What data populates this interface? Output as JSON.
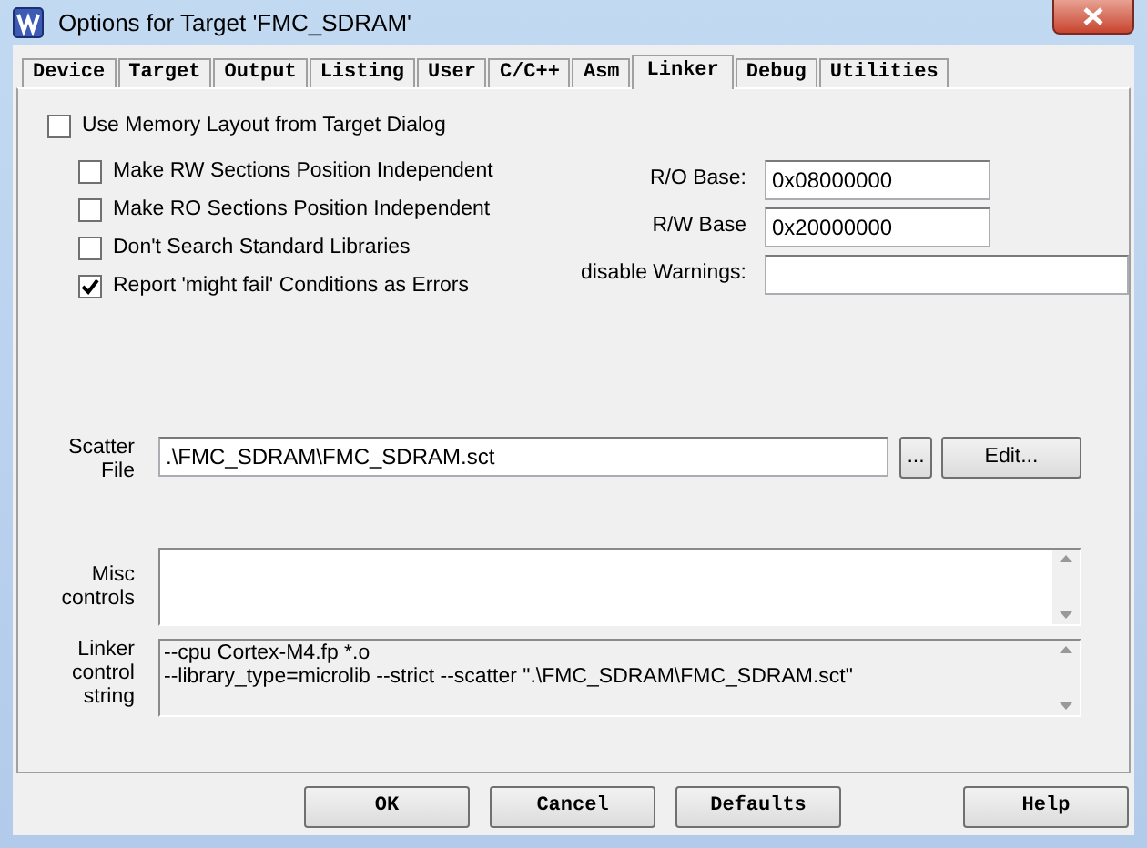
{
  "window": {
    "title": "Options for Target 'FMC_SDRAM'"
  },
  "tabs": [
    {
      "label": "Device",
      "selected": false
    },
    {
      "label": "Target",
      "selected": false
    },
    {
      "label": "Output",
      "selected": false
    },
    {
      "label": "Listing",
      "selected": false
    },
    {
      "label": "User",
      "selected": false
    },
    {
      "label": "C/C++",
      "selected": false
    },
    {
      "label": "Asm",
      "selected": false
    },
    {
      "label": "Linker",
      "selected": true
    },
    {
      "label": "Debug",
      "selected": false
    },
    {
      "label": "Utilities",
      "selected": false
    }
  ],
  "memory_layout": {
    "label": "Use Memory Layout from Target Dialog",
    "checked": false
  },
  "options": [
    {
      "label": "Make RW Sections Position Independent",
      "checked": false
    },
    {
      "label": "Make RO Sections Position Independent",
      "checked": false
    },
    {
      "label": "Don't Search Standard Libraries",
      "checked": false
    },
    {
      "label": "Report 'might fail' Conditions as Errors",
      "checked": true
    }
  ],
  "fields": [
    {
      "label": "R/O Base:",
      "value": "0x08000000",
      "kind": "short"
    },
    {
      "label": "R/W Base",
      "value": "0x20000000",
      "kind": "short"
    },
    {
      "label": "disable Warnings:",
      "kind": "long"
    }
  ],
  "scatter_file": {
    "label": "Scatter File",
    "value": ".\\FMC_SDRAM\\FMC_SDRAM.sct",
    "browse": "...",
    "edit": "Edit..."
  },
  "misc_controls": {
    "label": "Misc controls"
  },
  "linker_control_string": {
    "label": "Linker control string",
    "lines": [
      "--cpu Cortex-M4.fp *.o",
      "--library_type=microlib --strict --scatter \".\\FMC_SDRAM\\FMC_SDRAM.sct\""
    ]
  },
  "buttons": [
    "OK",
    "Cancel",
    "Defaults",
    "Help"
  ]
}
